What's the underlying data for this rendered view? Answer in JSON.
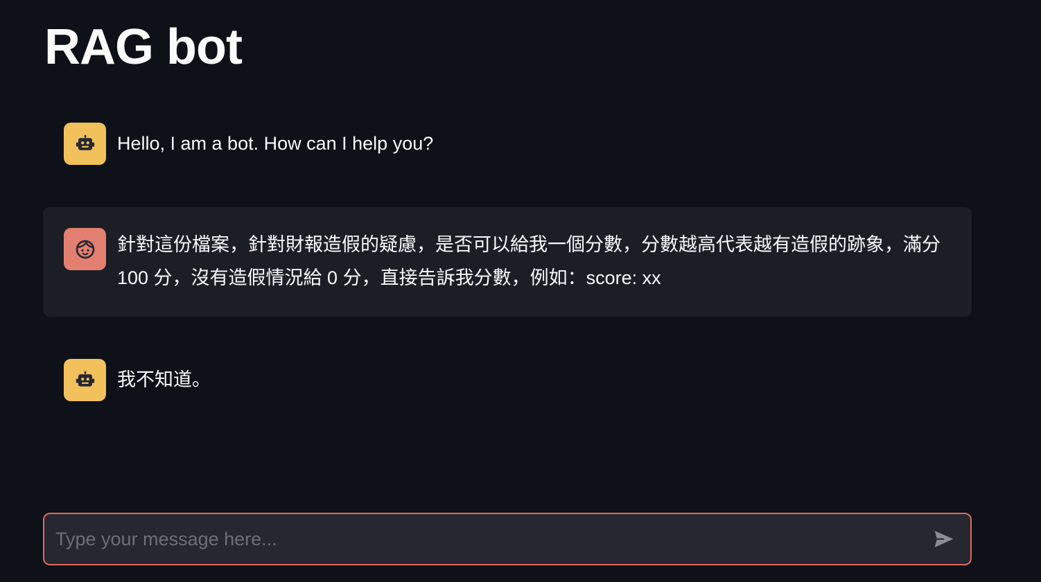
{
  "app": {
    "title": "RAG bot"
  },
  "messages": [
    {
      "role": "assistant",
      "avatar_icon": "robot-icon",
      "text": "Hello, I am a bot. How can I help you?"
    },
    {
      "role": "user",
      "avatar_icon": "user-face-icon",
      "text": "針對這份檔案，針對財報造假的疑慮，是否可以給我一個分數，分數越高代表越有造假的跡象，滿分 100 分，沒有造假情況給 0 分，直接告訴我分數，例如：score: xx"
    },
    {
      "role": "assistant",
      "avatar_icon": "robot-icon",
      "text": "我不知道。"
    }
  ],
  "chat_input": {
    "value": "",
    "placeholder": "Type your message here..."
  },
  "colors": {
    "background": "#0e1117",
    "bot_avatar": "#f2c15c",
    "user_avatar": "#e37f70",
    "user_message_bg": "#1c1e26",
    "input_border": "#e06b5e"
  }
}
